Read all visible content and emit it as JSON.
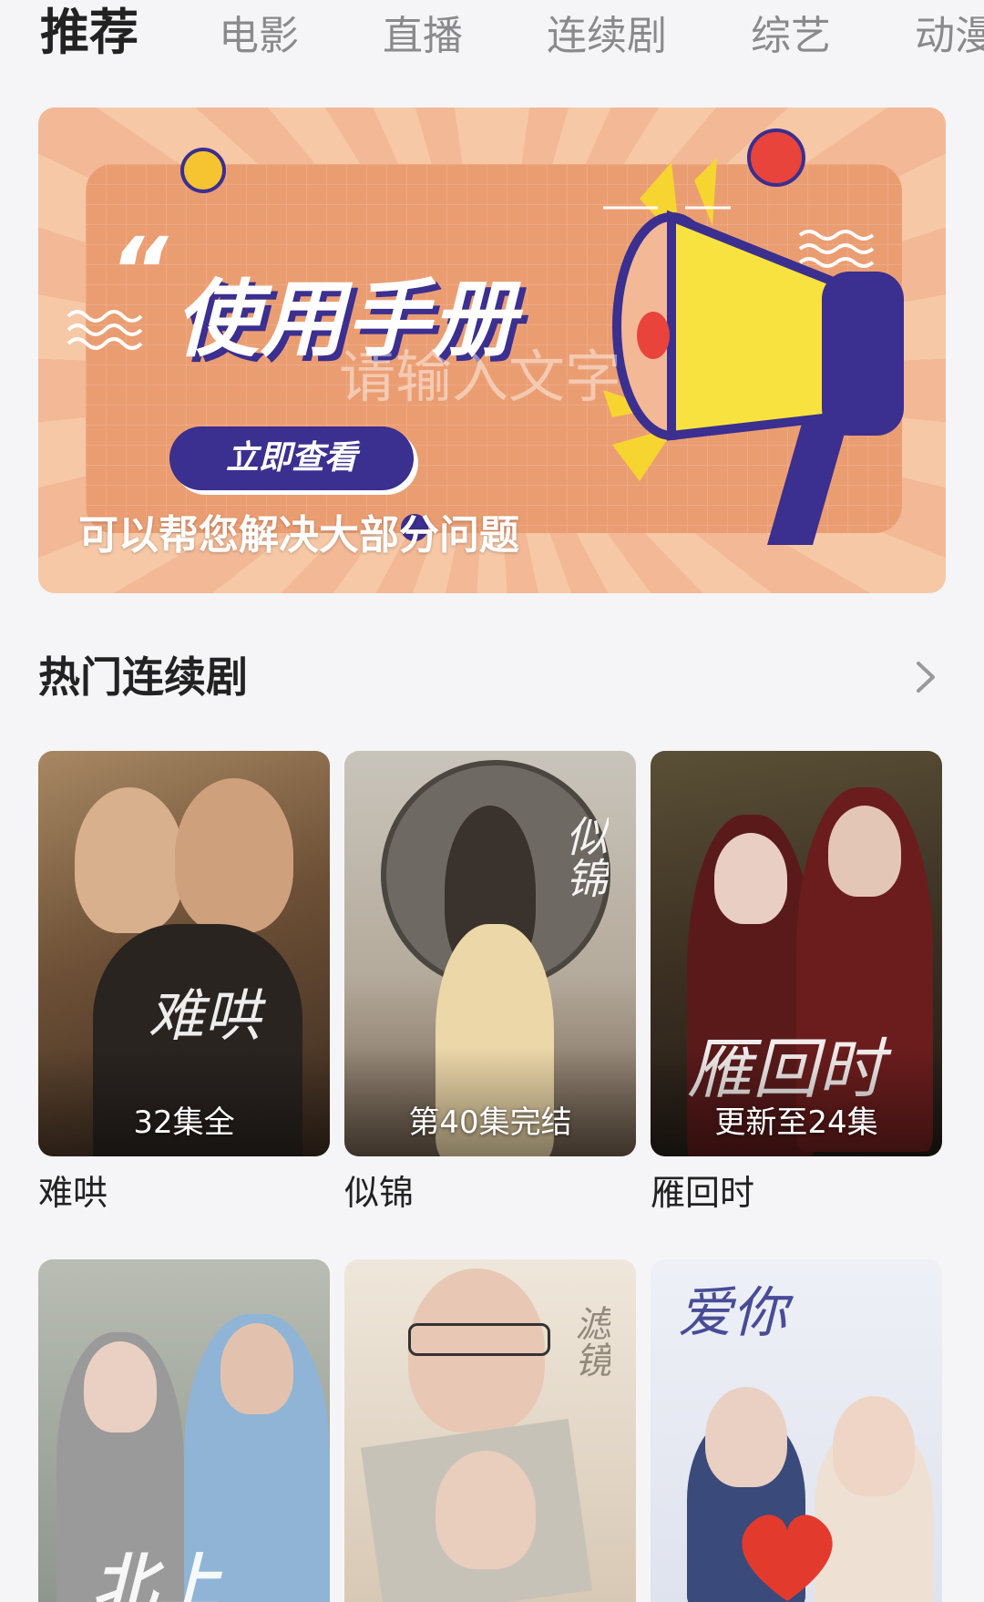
{
  "tabs": [
    {
      "label": "推荐",
      "active": true
    },
    {
      "label": "电影",
      "active": false
    },
    {
      "label": "直播",
      "active": false
    },
    {
      "label": "连续剧",
      "active": false
    },
    {
      "label": "综艺",
      "active": false
    },
    {
      "label": "动漫",
      "active": false
    }
  ],
  "banner": {
    "title": "使用手册",
    "button_label": "立即查看",
    "placeholder_overlay": "请输入文字",
    "subtitle": "可以帮您解决大部分问题",
    "quote_mark": "“"
  },
  "section": {
    "title": "热门连续剧",
    "more_icon": "chevron-right-icon"
  },
  "shows": [
    {
      "title": "难哄",
      "badge": "32集全",
      "art_text": "难哄"
    },
    {
      "title": "似锦",
      "badge": "第40集完结",
      "art_text": "似锦"
    },
    {
      "title": "雁回时",
      "badge": "更新至24集",
      "art_text": "雁回时"
    },
    {
      "title": "",
      "badge": "",
      "art_text": "北上"
    },
    {
      "title": "",
      "badge": "",
      "art_text": "滤镜"
    },
    {
      "title": "",
      "badge": "",
      "art_text": "爱你"
    }
  ],
  "colors": {
    "active_tab": "#222222",
    "inactive_tab": "#8a8a8e",
    "banner_accent": "#3b2f8f",
    "banner_orange": "#eb9d72",
    "background": "#f5f5f7"
  }
}
